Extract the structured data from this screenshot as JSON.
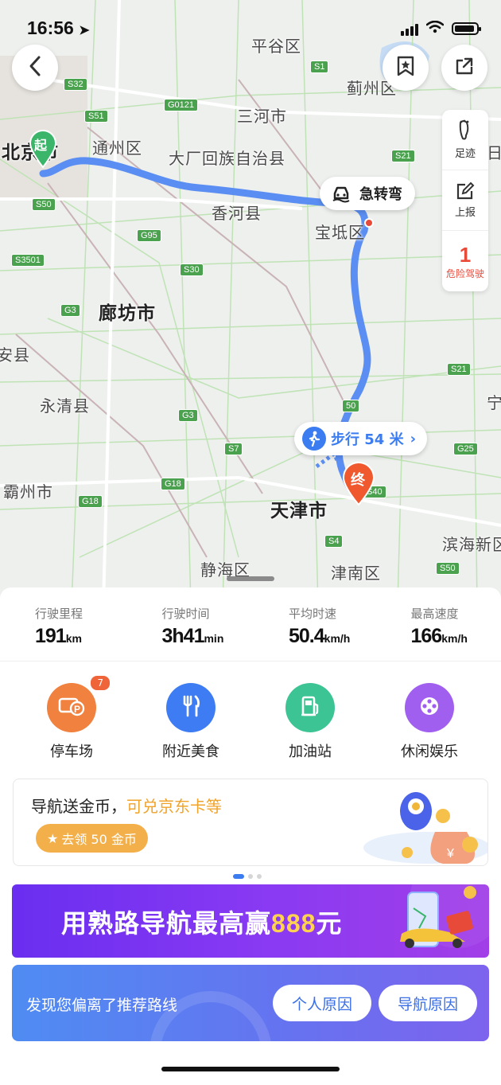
{
  "status": {
    "time": "16:56"
  },
  "map": {
    "places": {
      "pinggu": "平谷区",
      "jizhou": "蓟州区",
      "sanhe": "三河市",
      "beijing": "北京市",
      "tongzhou": "通州区",
      "dachang": "大厂回族自治县",
      "xianghe": "香河县",
      "baodi": "宝坻区",
      "langfang": "廊坊市",
      "anxian": "安县",
      "yongqing": "永清县",
      "bazhou": "霸州市",
      "tianjin": "天津市",
      "binhai": "滨海新区",
      "jinghai": "静海区",
      "jinnan": "津南区",
      "ning": "宁",
      "ri": "日"
    },
    "shields": [
      "S32",
      "S51",
      "G0121",
      "S1",
      "S50",
      "G95",
      "S3501",
      "S30",
      "G3",
      "G3",
      "S21",
      "S21",
      "G25",
      "S7",
      "G18",
      "G18",
      "S4",
      "S50",
      "S40",
      "50"
    ],
    "start_label": "起",
    "end_label": "终",
    "sharp_turn_label": "急转弯",
    "walk_label": "步行 54 米",
    "tools": {
      "footprint_label": "足迹",
      "report_label": "上报",
      "danger_count": "1",
      "danger_label": "危险驾驶"
    },
    "route_color": "#5b8ef2"
  },
  "stats": [
    {
      "label": "行驶里程",
      "value": "191",
      "unit": "km"
    },
    {
      "label": "行驶时间",
      "value": "3h41",
      "unit": "min"
    },
    {
      "label": "平均时速",
      "value": "50.4",
      "unit": "km/h"
    },
    {
      "label": "最高速度",
      "value": "166",
      "unit": "km/h"
    }
  ],
  "pois": [
    {
      "label": "停车场",
      "icon": "parking-icon",
      "color": "#f0813f",
      "badge": "7"
    },
    {
      "label": "附近美食",
      "icon": "food-icon",
      "color": "#3d7cf2"
    },
    {
      "label": "加油站",
      "icon": "gas-station-icon",
      "color": "#3cc494"
    },
    {
      "label": "休闲娱乐",
      "icon": "entertainment-icon",
      "color": "#a15ff0"
    }
  ],
  "coin_card": {
    "title": "导航送金币，",
    "title_highlight": "可兑京东卡等",
    "button": "去领 50 金币"
  },
  "promo": {
    "text": "用熟路导航最高赢",
    "amount": "888",
    "suffix": "元"
  },
  "deviate": {
    "text": "发现您偏离了推荐路线",
    "personal": "个人原因",
    "navigation": "导航原因"
  }
}
